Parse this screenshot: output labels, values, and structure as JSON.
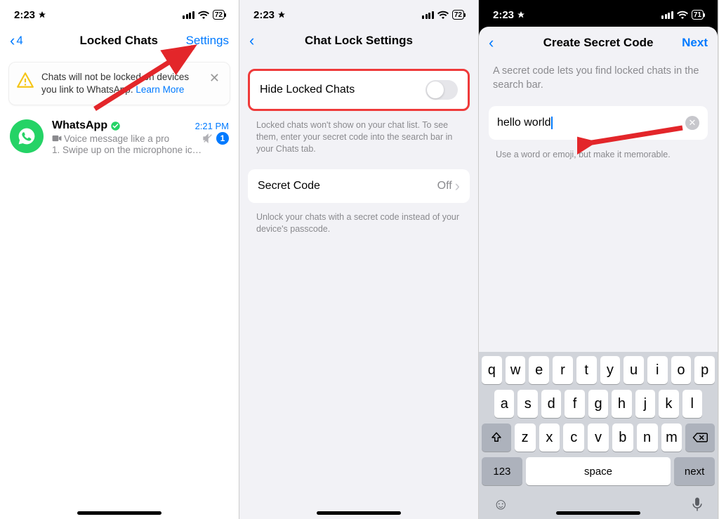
{
  "status": {
    "time": "2:23",
    "battery1": "72",
    "battery2": "72",
    "battery3": "71"
  },
  "screen1": {
    "back_count": "4",
    "title": "Locked Chats",
    "settings": "Settings",
    "banner_text": "Chats will not be locked on devices you link to WhatsApp. ",
    "learn_more": "Learn More",
    "chat": {
      "name": "WhatsApp",
      "time": "2:21 PM",
      "line1": "Voice message like a pro",
      "line2": "1. Swipe up on the microphone ic…",
      "unread": "1"
    }
  },
  "screen2": {
    "title": "Chat Lock Settings",
    "row1": "Hide Locked Chats",
    "caption1": "Locked chats won't show on your chat list. To see them, enter your secret code into the search bar in your Chats tab.",
    "row2": "Secret Code",
    "row2_value": "Off",
    "caption2": "Unlock your chats with a secret code instead of your device's passcode."
  },
  "screen3": {
    "title": "Create Secret Code",
    "next": "Next",
    "desc": "A secret code lets you find locked chats in the search bar.",
    "input": "hello world",
    "hint": "Use a word or emoji, but make it memorable."
  },
  "keyboard": {
    "row1": [
      "q",
      "w",
      "e",
      "r",
      "t",
      "y",
      "u",
      "i",
      "o",
      "p"
    ],
    "row2": [
      "a",
      "s",
      "d",
      "f",
      "g",
      "h",
      "j",
      "k",
      "l"
    ],
    "row3": [
      "z",
      "x",
      "c",
      "v",
      "b",
      "n",
      "m"
    ],
    "numKey": "123",
    "space": "space",
    "next": "next"
  }
}
